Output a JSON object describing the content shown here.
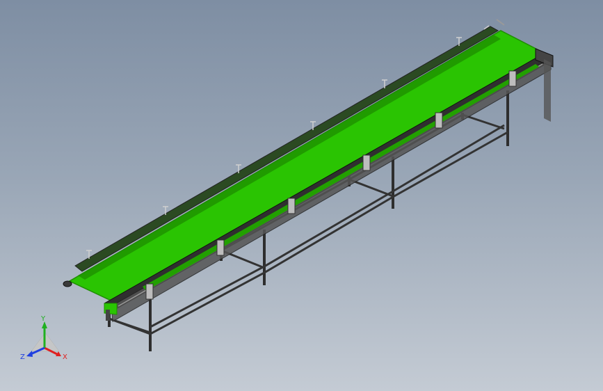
{
  "viewport": {
    "background_top": "#7e8ea3",
    "background_bottom": "#c4cbd4"
  },
  "model": {
    "belt_color": "#2ac402",
    "belt_edge_color": "#1f8f00",
    "frame_color": "#3a3a3a"
  },
  "triad": {
    "x_label": "X",
    "y_label": "Y",
    "z_label": "Z",
    "x_color": "#e02020",
    "y_color": "#20b020",
    "z_color": "#2040e0"
  }
}
